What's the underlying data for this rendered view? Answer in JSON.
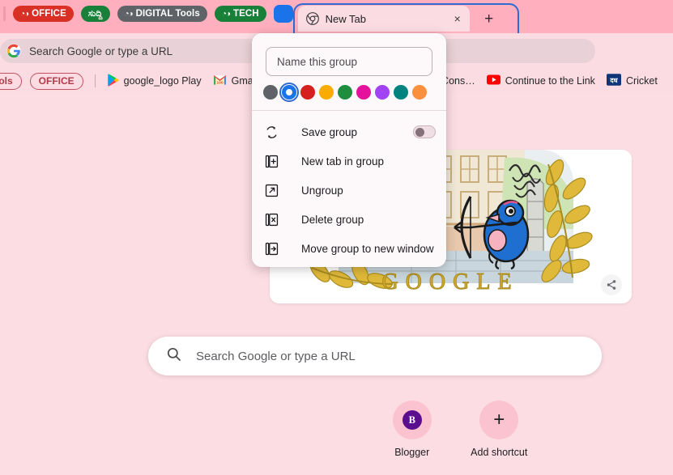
{
  "window": {
    "tabstrip_bg": "#ffafbd",
    "toolbar_bg": "#fbdce3",
    "page_bg": "#fcdde4"
  },
  "tabstrip": {
    "group_chips": [
      {
        "label": "OFFICE",
        "color": "#d93025",
        "text_color": "#ffffff",
        "icon": "tab-group-icon",
        "shape": "pill"
      },
      {
        "label": "ಸುದ್ದಿ",
        "color": "#188038",
        "text_color": "#ffffff",
        "icon": "",
        "shape": "pill"
      },
      {
        "label": "DIGITAL Tools",
        "color": "#5f6368",
        "text_color": "#ffffff",
        "icon": "tab-group-icon",
        "shape": "pill"
      },
      {
        "label": "TECH",
        "color": "#188038",
        "text_color": "#ffffff",
        "icon": "tab-group-icon",
        "shape": "pill"
      },
      {
        "label": "",
        "color": "#1a73e8",
        "text_color": "#ffffff",
        "icon": "",
        "shape": "square"
      }
    ],
    "active_tab": {
      "title": "New Tab",
      "favicon": "chrome-logo-icon",
      "close_label": "×",
      "group_outline_color": "#2f6ad1"
    },
    "new_tab_button_label": "+"
  },
  "omnibox": {
    "icon": "google-g-icon",
    "placeholder": "Search Google or type a URL",
    "value": ""
  },
  "bookmarks": [
    {
      "type": "pill-cut",
      "label": "ools",
      "icon": ""
    },
    {
      "type": "pill",
      "label": "OFFICE",
      "icon": ""
    },
    {
      "type": "divider",
      "label": "",
      "icon": ""
    },
    {
      "type": "link",
      "label": "google_logo Play",
      "icon": "google-play-icon"
    },
    {
      "type": "link",
      "label": "Gmail",
      "icon": "gmail-icon"
    },
    {
      "type": "link",
      "label": "arch Cons…",
      "icon": ""
    },
    {
      "type": "link",
      "label": "Continue to the Link",
      "icon": "youtube-icon"
    },
    {
      "type": "link",
      "label": "Cricket",
      "icon": "dainik-bhaskar-icon"
    }
  ],
  "tab_group_bubble": {
    "name_input": {
      "value": "",
      "placeholder": "Name this group"
    },
    "colors": [
      {
        "name": "grey",
        "hex": "#5f6368",
        "selected": false
      },
      {
        "name": "blue",
        "hex": "#1a73e8",
        "selected": true
      },
      {
        "name": "red",
        "hex": "#d62020",
        "selected": false
      },
      {
        "name": "yellow",
        "hex": "#f9ab00",
        "selected": false
      },
      {
        "name": "green",
        "hex": "#1e8e3e",
        "selected": false
      },
      {
        "name": "pink",
        "hex": "#e3119b",
        "selected": false
      },
      {
        "name": "purple",
        "hex": "#a142f4",
        "selected": false
      },
      {
        "name": "cyan",
        "hex": "#00827f",
        "selected": false
      },
      {
        "name": "orange",
        "hex": "#fa903e",
        "selected": false
      }
    ],
    "menu_items": [
      {
        "label": "Save group",
        "icon": "save-group-icon",
        "has_toggle": true,
        "toggle_on": false
      },
      {
        "label": "New tab in group",
        "icon": "new-tab-in-group-icon",
        "has_toggle": false,
        "toggle_on": false
      },
      {
        "label": "Ungroup",
        "icon": "ungroup-icon",
        "has_toggle": false,
        "toggle_on": false
      },
      {
        "label": "Delete group",
        "icon": "delete-group-icon",
        "has_toggle": false,
        "toggle_on": false
      },
      {
        "label": "Move group to new window",
        "icon": "move-group-icon",
        "has_toggle": false,
        "toggle_on": false
      }
    ]
  },
  "new_tab_page": {
    "doodle": {
      "alt": "Google Doodle — archery bird",
      "wordmark": "GOOGLE",
      "share_icon": "share-icon"
    },
    "search": {
      "icon": "search-icon",
      "placeholder": "Search Google or type a URL",
      "value": ""
    },
    "shortcuts": [
      {
        "label": "Blogger",
        "icon_letter": "B",
        "icon_color": "#5b0f8e",
        "type": "site"
      },
      {
        "label": "Add shortcut",
        "icon_letter": "+",
        "icon_color": "",
        "type": "add"
      }
    ]
  }
}
